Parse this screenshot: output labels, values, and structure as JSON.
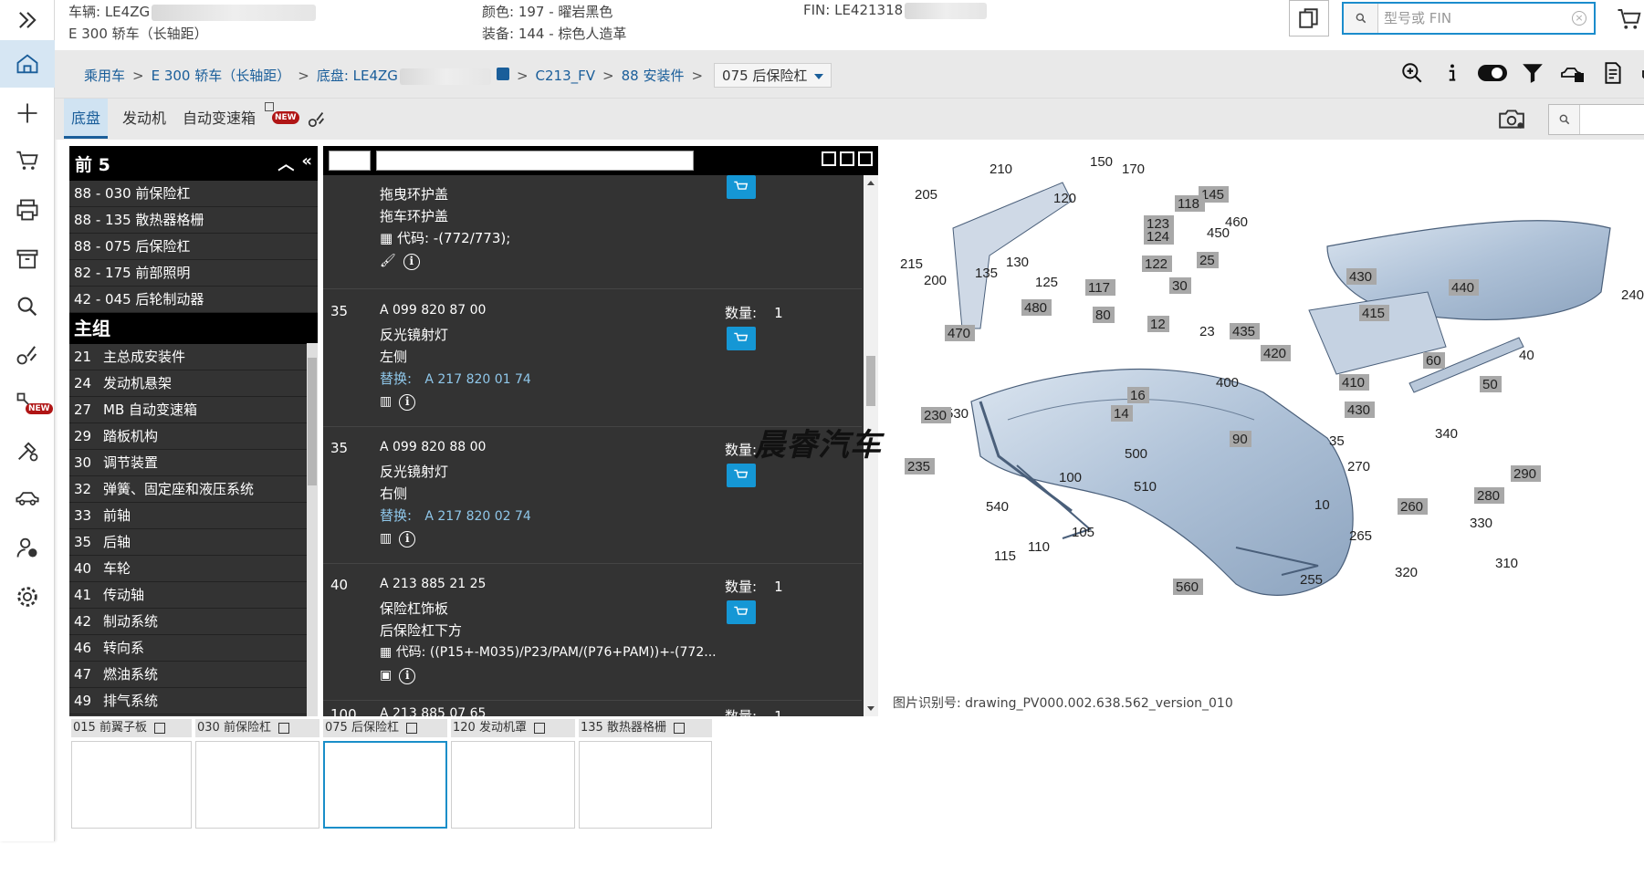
{
  "vehicle": {
    "vin_label": "车辆: LE4ZG",
    "model": "E 300 轿车（长轴距）",
    "color": "颜色: 197 - 曜岩黑色",
    "trim": "装备: 144 - 棕色人造革",
    "fin_label": "FIN: LE421318"
  },
  "search": {
    "placeholder": "型号或 FIN"
  },
  "breadcrumb": {
    "items": [
      "乘用车",
      "E 300 轿车（长轴距）",
      "底盘: LE4ZG",
      "C213_FV",
      "88 安装件"
    ],
    "current": "075 后保险杠"
  },
  "tabs": [
    "底盘",
    "发动机",
    "自动变速箱"
  ],
  "badge_new": "NEW",
  "front_panel": {
    "title": "前 5",
    "items": [
      "88 - 030 前保险杠",
      "88 - 135 散热器格栅",
      "88 - 075 后保险杠",
      "82 - 175 前部照明",
      "42 - 045 后轮制动器"
    ]
  },
  "main_group": {
    "title": "主组",
    "items": [
      {
        "code": "21",
        "label": "主总成安装件"
      },
      {
        "code": "24",
        "label": "发动机悬架"
      },
      {
        "code": "27",
        "label": "MB 自动变速箱"
      },
      {
        "code": "29",
        "label": "踏板机构"
      },
      {
        "code": "30",
        "label": "调节装置"
      },
      {
        "code": "32",
        "label": "弹簧、固定座和液压系统"
      },
      {
        "code": "33",
        "label": "前轴"
      },
      {
        "code": "35",
        "label": "后轴"
      },
      {
        "code": "40",
        "label": "车轮"
      },
      {
        "code": "41",
        "label": "传动轴"
      },
      {
        "code": "42",
        "label": "制动系统"
      },
      {
        "code": "46",
        "label": "转向系"
      },
      {
        "code": "47",
        "label": "燃油系统"
      },
      {
        "code": "49",
        "label": "排气系统"
      }
    ]
  },
  "parts": {
    "qty_label": "数量:",
    "replace_label": "替换:",
    "code_label": "代码:",
    "partial": {
      "name": "拖曳环护盖",
      "desc": "拖车环护盖",
      "code": "-(772/773);"
    },
    "items": [
      {
        "pos": "35",
        "number": "A 099 820 87 00",
        "name": "反光镜射灯",
        "desc": "左侧",
        "qty": "1",
        "replacement": "A 217 820 01 74"
      },
      {
        "pos": "35",
        "number": "A 099 820 88 00",
        "name": "反光镜射灯",
        "desc": "右侧",
        "qty": "",
        "replacement": "A 217 820 02 74"
      },
      {
        "pos": "40",
        "number": "A 213 885 21 25",
        "name": "保险杠饰板",
        "desc": "后保险杠下方",
        "qty": "1",
        "code": "((P15+-M035)/P23/PAM/(P76+PAM))+-(772..."
      },
      {
        "pos": "100",
        "number": "A 213 885 07 65",
        "name": "",
        "desc": "",
        "qty": "1"
      }
    ]
  },
  "watermark": "晨睿汽车",
  "drawing": {
    "image_id": "图片识别号: drawing_PV000.002.638.562_version_010",
    "callouts_plain": [
      "210",
      "150",
      "170",
      "205",
      "120",
      "215",
      "200",
      "135",
      "130",
      "125",
      "460",
      "450",
      "23",
      "400",
      "40",
      "240",
      "530",
      "500",
      "510",
      "100",
      "540",
      "105",
      "110",
      "115",
      "35",
      "270",
      "340",
      "330",
      "310",
      "320",
      "265",
      "255",
      "10"
    ],
    "callouts_boxed": [
      "145",
      "118",
      "123",
      "124",
      "122",
      "25",
      "117",
      "30",
      "440",
      "430",
      "480",
      "80",
      "12",
      "415",
      "470",
      "435",
      "420",
      "60",
      "410",
      "50",
      "16",
      "430",
      "14",
      "230",
      "90",
      "235",
      "290",
      "280",
      "260",
      "560"
    ]
  },
  "thumbnails": [
    {
      "label": "015 前翼子板",
      "active": false
    },
    {
      "label": "030 前保险杠",
      "active": false
    },
    {
      "label": "075 后保险杠",
      "active": true
    },
    {
      "label": "120 发动机罩",
      "active": false
    },
    {
      "label": "135 散热器格栅",
      "active": false
    }
  ],
  "icons": {
    "rail": [
      "double-chevron-right-icon",
      "home-icon",
      "plus-icon",
      "cart-icon",
      "printer-icon",
      "archive-icon",
      "search-icon",
      "parts-icon",
      "new-parts-icon",
      "tools-icon",
      "car-icon",
      "user-info-icon",
      "gear-icon"
    ],
    "toolbar": [
      "zoom-in-icon",
      "info-icon",
      "toggle-icon",
      "filter-icon",
      "vehicle-data-icon",
      "document-icon",
      "engine-icon",
      "info-circle-icon"
    ]
  },
  "colors": {
    "accent": "#1a5e9a",
    "cart": "#1597d5",
    "panel": "#333333"
  }
}
